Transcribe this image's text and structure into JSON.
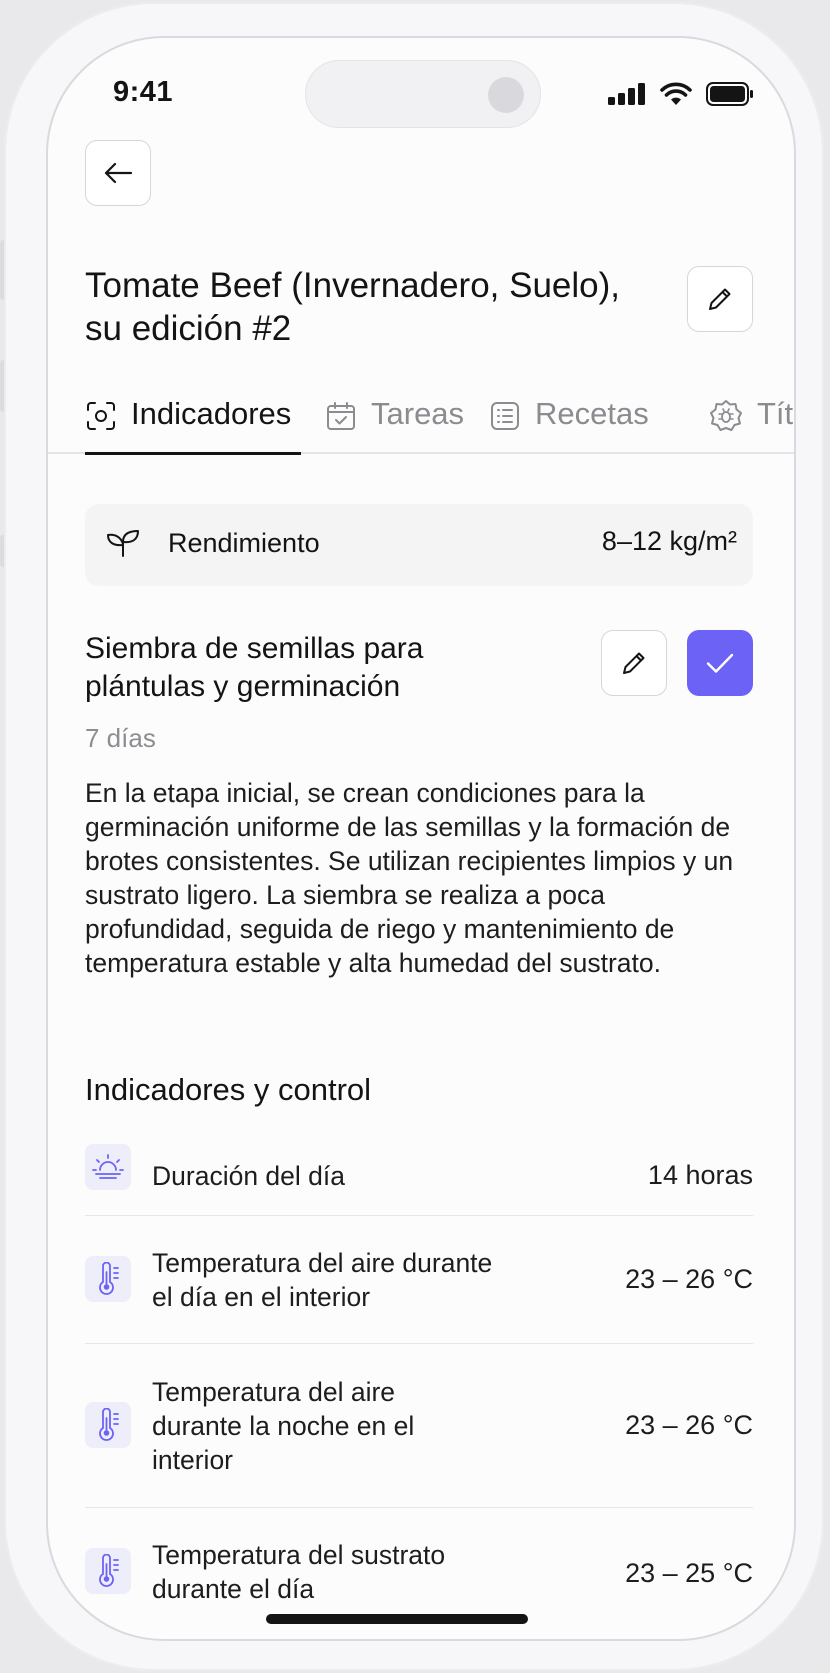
{
  "status_bar": {
    "time": "9:41"
  },
  "header": {
    "title": "Tomate Beef (Invernadero, Suelo), su edición #2"
  },
  "tabs": [
    {
      "label": "Indicadores"
    },
    {
      "label": "Tareas"
    },
    {
      "label": "Recetas"
    },
    {
      "label": "Títulos"
    }
  ],
  "yield": {
    "label": "Rendimiento",
    "value": "8–12 kg/m²"
  },
  "stage": {
    "title": "Siembra de semillas para plántulas y germinación",
    "duration": "7 días",
    "description": "En la etapa inicial, se crean condiciones para la germinación uniforme de las semillas y la formación de brotes consistentes. Se utilizan recipientes limpios y un sustrato ligero. La siembra se realiza a poca profundidad, seguida de riego y mantenimiento de temperatura estable y alta humedad del sustrato."
  },
  "indicators": {
    "heading": "Indicadores y control",
    "items": [
      {
        "label": "Duración del día",
        "value": "14 horas",
        "icon": "sunrise-icon"
      },
      {
        "label": "Temperatura del aire durante el día en el interior",
        "value": "23 – 26 °C",
        "icon": "thermometer-icon"
      },
      {
        "label": "Temperatura del aire durante la noche en el interior",
        "value": "23 – 26 °C",
        "icon": "thermometer-icon"
      },
      {
        "label": "Temperatura del sustrato durante el día",
        "value": "23 – 25 °C",
        "icon": "thermometer-icon"
      }
    ]
  },
  "colors": {
    "accent": "#6c63f6",
    "icon_bg": "#eeeefb",
    "card_bg": "#f4f4f5"
  }
}
